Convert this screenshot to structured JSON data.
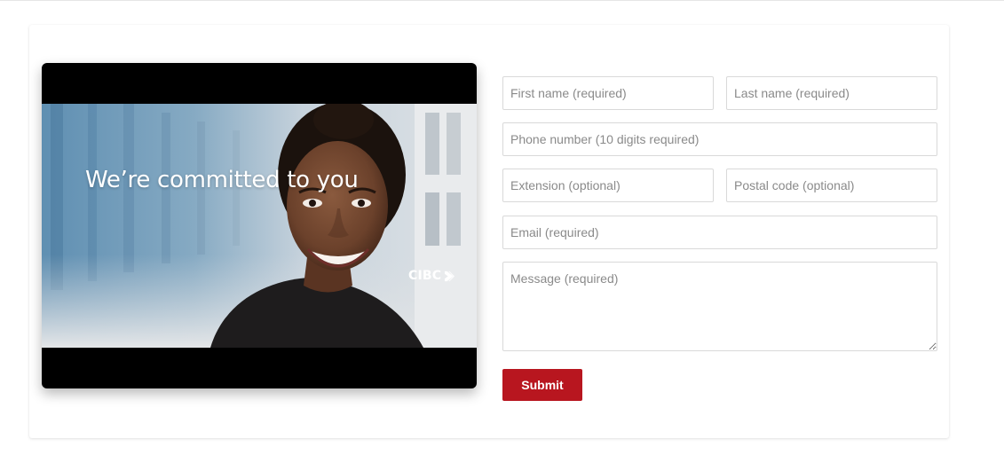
{
  "video": {
    "caption": "We’re committed to you",
    "brand": "CIBC"
  },
  "form": {
    "first_name": {
      "placeholder": "First name (required)"
    },
    "last_name": {
      "placeholder": "Last name (required)"
    },
    "phone": {
      "placeholder": "Phone number (10 digits required)"
    },
    "extension": {
      "placeholder": "Extension (optional)"
    },
    "postal": {
      "placeholder": "Postal code (optional)"
    },
    "email": {
      "placeholder": "Email (required)"
    },
    "message": {
      "placeholder": "Message (required)"
    },
    "submit_label": "Submit"
  },
  "colors": {
    "accent": "#b8161f",
    "border": "#d9d9d9",
    "placeholder": "#8a8a8a"
  }
}
